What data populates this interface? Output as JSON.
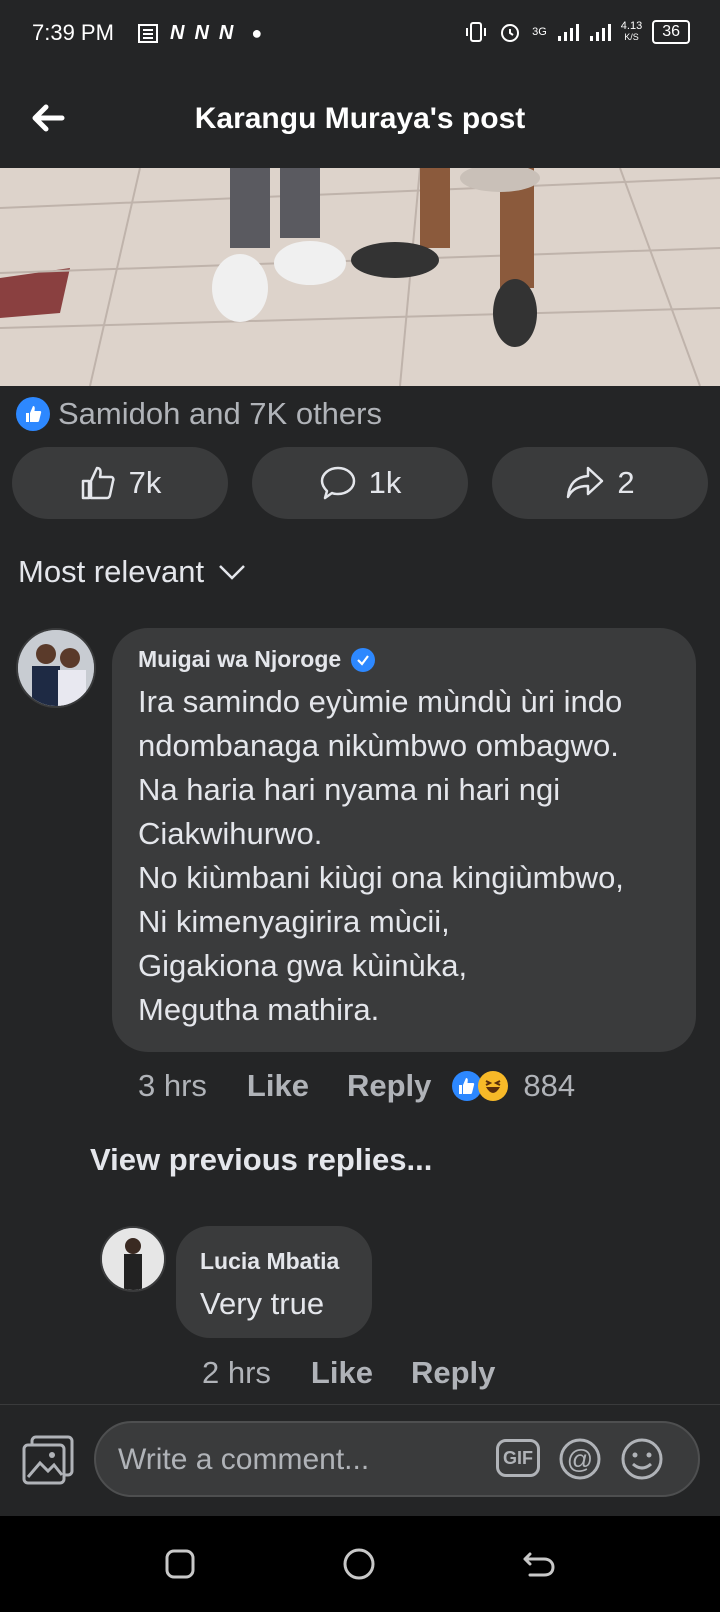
{
  "status_bar": {
    "time": "7:39 PM",
    "network": "3G",
    "speed": "4.13",
    "speed_unit": "K/S",
    "battery": "36"
  },
  "header": {
    "title": "Karangu Muraya's post"
  },
  "post": {
    "likes_summary": "Samidoh and 7K others",
    "actions": {
      "like_count": "7k",
      "comment_count": "1k",
      "share_count": "2"
    }
  },
  "sort": {
    "label": "Most relevant"
  },
  "comments": [
    {
      "author": "Muigai wa Njoroge",
      "verified": true,
      "text": "Ira samindo eyùmie mùndù ùri indo\nndombanaga nikùmbwo ombagwo.\nNa haria hari nyama ni hari ngi\nCiakwihurwo.\nNo kiùmbani kiùgi ona kingiùmbwo,\nNi kimenyagirira mùcii,\nGigakiona gwa kùinùka,\nMegutha mathira.",
      "time": "3 hrs",
      "like_label": "Like",
      "reply_label": "Reply",
      "reaction_count": "884"
    }
  ],
  "view_previous": "View previous replies...",
  "replies": [
    {
      "author": "Lucia Mbatia",
      "text": "Very true",
      "time": "2 hrs",
      "like_label": "Like",
      "reply_label": "Reply"
    }
  ],
  "composer": {
    "placeholder": "Write a comment...",
    "gif_label": "GIF"
  },
  "colors": {
    "accent": "#2d88ff",
    "background": "#242526",
    "bubble": "#3a3b3c",
    "secondary_text": "#b0b3b8"
  }
}
